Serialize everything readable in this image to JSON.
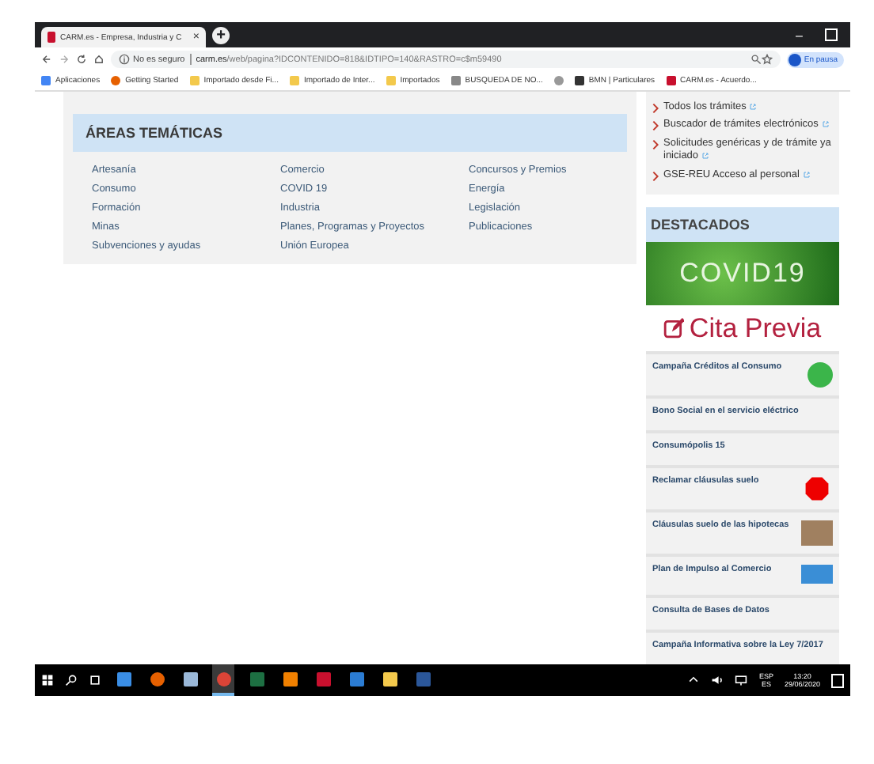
{
  "browser": {
    "tab": {
      "title": "CARM.es - Empresa, Industria y C",
      "close": "×"
    },
    "new_tab": "+",
    "minimize": "–",
    "address": {
      "security": "No es seguro",
      "domain": "carm.es",
      "path": "/web/pagina?IDCONTENIDO=818&IDTIPO=140&RASTRO=c$m59490"
    },
    "profile": "En pausa",
    "bookmarks": [
      {
        "label": "Aplicaciones",
        "kind": "apps"
      },
      {
        "label": "Getting Started",
        "kind": "firefox"
      },
      {
        "label": "Importado desde Fi...",
        "kind": "folder"
      },
      {
        "label": "Importado de Inter...",
        "kind": "folder"
      },
      {
        "label": "Importados",
        "kind": "folder"
      },
      {
        "label": "BUSQUEDA DE NO...",
        "kind": "page"
      },
      {
        "kind": "globe"
      },
      {
        "label": "BMN | Particulares",
        "kind": "bank"
      },
      {
        "label": "CARM.es - Acuerdo...",
        "kind": "carm"
      }
    ]
  },
  "areas": {
    "title": "ÁREAS TEMÁTICAS",
    "columns": [
      [
        "Artesanía",
        "Consumo",
        "Formación",
        "Minas",
        "Subvenciones y ayudas"
      ],
      [
        "Comercio",
        "COVID 19",
        "Industria",
        "Planes, Programas y Proyectos",
        "Unión Europea"
      ],
      [
        "Concursos y Premios",
        "Energía",
        "Legislación",
        "Publicaciones"
      ]
    ]
  },
  "links": [
    {
      "label": "Todos los trámites"
    },
    {
      "label": "Buscador de trámites electrónicos"
    },
    {
      "label": "Solicitudes genéricas y de trámite ya iniciado"
    },
    {
      "label": "GSE-REU Acceso al personal"
    }
  ],
  "destacados": {
    "title": "DESTACADOS",
    "covid": "COVID19",
    "cita": "Cita Previa",
    "items": [
      {
        "label": "Campaña Créditos al Consumo",
        "kind": "badge"
      },
      {
        "label": "Bono Social en el servicio eléctrico",
        "kind": "text"
      },
      {
        "label": "Consumópolis 15",
        "kind": "text"
      },
      {
        "label": "Reclamar cláusulas suelo",
        "kind": "stop"
      },
      {
        "label": "Cláusulas suelo de las hipotecas",
        "kind": "photo"
      },
      {
        "label": "Plan de Impulso al Comercio",
        "kind": "card"
      },
      {
        "label": "Consulta de Bases de Datos",
        "kind": "text"
      },
      {
        "label": "Campaña Informativa sobre la Ley 7/2017",
        "kind": "text"
      }
    ]
  },
  "taskbar": {
    "apps": [
      {
        "kind": "explorer",
        "selected": false
      },
      {
        "kind": "firefox",
        "selected": false
      },
      {
        "kind": "notes",
        "selected": false
      },
      {
        "kind": "chrome",
        "selected": true
      },
      {
        "kind": "excel",
        "selected": false
      },
      {
        "kind": "vlc",
        "selected": false
      },
      {
        "kind": "red",
        "selected": false
      },
      {
        "kind": "edge",
        "selected": false
      },
      {
        "kind": "folder",
        "selected": false
      },
      {
        "kind": "word",
        "selected": false
      }
    ],
    "lang": "ESP",
    "region": "ES",
    "time": "13:20",
    "date": "29/06/2020"
  }
}
